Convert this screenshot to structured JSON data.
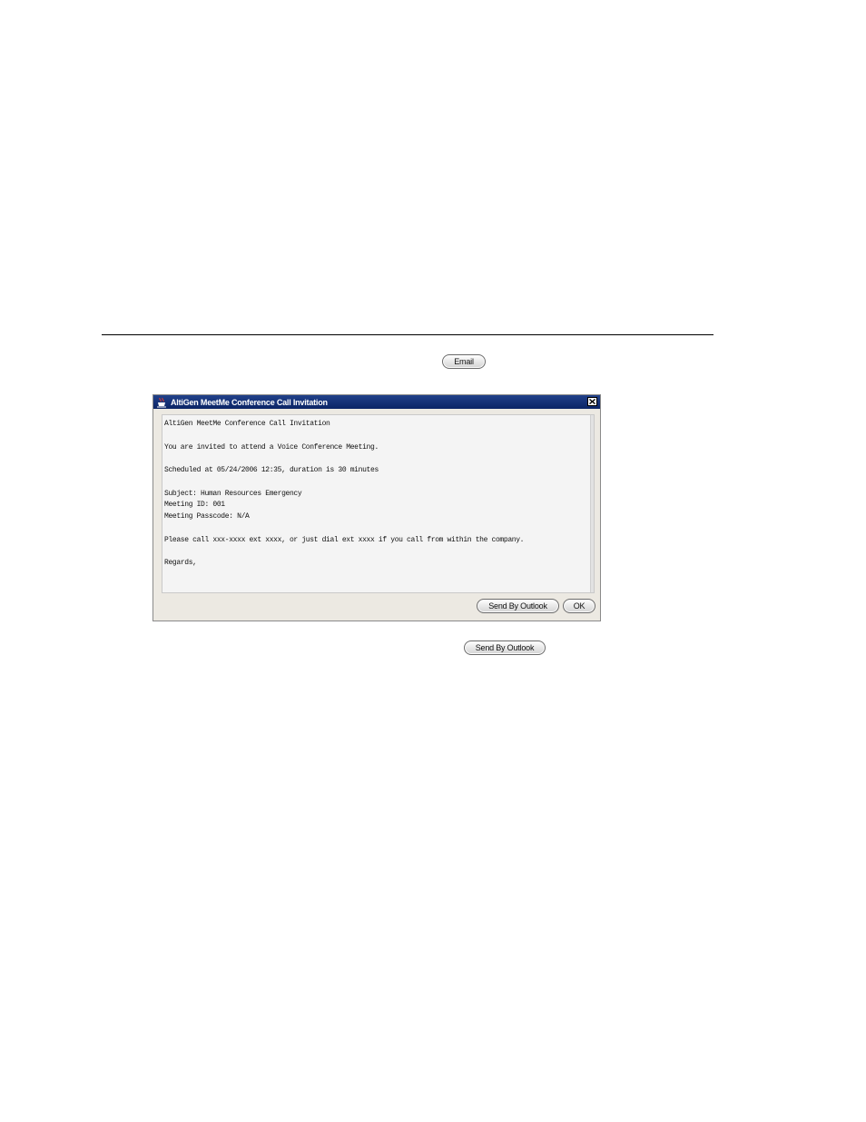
{
  "document": {
    "email_button_label": "Email",
    "send_outlook_button_label": "Send By Outlook"
  },
  "dialog": {
    "title": "AltiGen MeetMe Conference Call Invitation",
    "message_lines": [
      "AltiGen MeetMe Conference Call Invitation",
      "You are invited to attend a Voice Conference Meeting.",
      "Scheduled at 05/24/2006 12:35, duration is 30 minutes",
      "Subject: Human Resources Emergency",
      "Meeting ID: 001",
      "Meeting Passcode: N/A",
      "Please call xxx-xxxx ext xxxx, or just dial ext xxxx if you call from within the company.",
      "Regards,"
    ],
    "send_outlook_label": "Send By Outlook",
    "ok_label": "OK"
  },
  "icons": {
    "title_icon": "java-cup-icon",
    "close": "close-icon"
  },
  "colors": {
    "titlebar": "#0b2465",
    "dialog_bg": "#ece9e2",
    "text_area_bg": "#f4f4f4"
  }
}
